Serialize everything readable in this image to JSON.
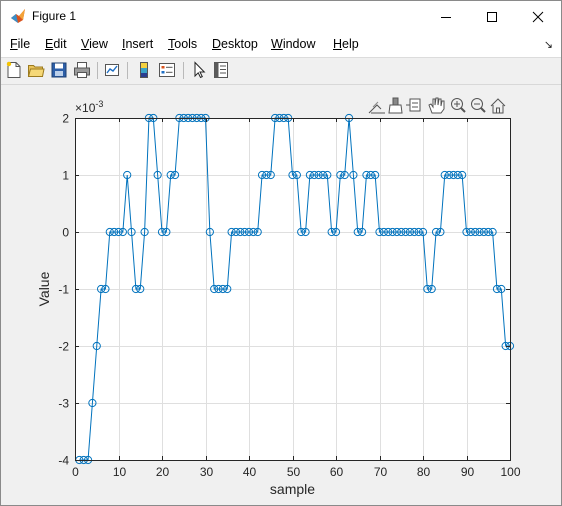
{
  "window": {
    "title": "Figure 1",
    "controls": [
      "minimize-icon",
      "maximize-icon",
      "close-icon"
    ]
  },
  "menu": {
    "items": [
      "File",
      "Edit",
      "View",
      "Insert",
      "Tools",
      "Desktop",
      "Window",
      "Help"
    ],
    "overflow_icon": "dock-arrow-icon"
  },
  "toolbar": {
    "buttons": [
      "new-figure-icon",
      "open-file-icon",
      "save-icon",
      "print-icon",
      "link-plot-icon",
      "insert-colorbar-icon",
      "insert-legend-icon",
      "edit-plot-icon",
      "property-inspector-icon"
    ]
  },
  "axes_toolbar": {
    "buttons": [
      "export-icon",
      "brush-icon",
      "data-tips-icon",
      "pan-icon",
      "zoom-in-icon",
      "zoom-out-icon",
      "restore-view-icon"
    ]
  },
  "chart_data": {
    "type": "line",
    "marker": "circle",
    "color": "#0072bd",
    "xlabel": "sample",
    "ylabel": "Value",
    "exponent_label": "10",
    "exponent_prefix": "×",
    "exponent_power": "-3",
    "xlim": [
      0,
      100
    ],
    "ylim": [
      -4,
      2
    ],
    "grid": true,
    "xticks": [
      "0",
      "10",
      "20",
      "30",
      "40",
      "50",
      "60",
      "70",
      "80",
      "90",
      "100"
    ],
    "yticks": [
      "-4",
      "-3",
      "-2",
      "-1",
      "0",
      "1",
      "2"
    ],
    "x": [
      1,
      2,
      3,
      4,
      5,
      6,
      7,
      8,
      9,
      10,
      11,
      12,
      13,
      14,
      15,
      16,
      17,
      18,
      19,
      20,
      21,
      22,
      23,
      24,
      25,
      26,
      27,
      28,
      29,
      30,
      31,
      32,
      33,
      34,
      35,
      36,
      37,
      38,
      39,
      40,
      41,
      42,
      43,
      44,
      45,
      46,
      47,
      48,
      49,
      50,
      51,
      52,
      53,
      54,
      55,
      56,
      57,
      58,
      59,
      60,
      61,
      62,
      63,
      64,
      65,
      66,
      67,
      68,
      69,
      70,
      71,
      72,
      73,
      74,
      75,
      76,
      77,
      78,
      79,
      80,
      81,
      82,
      83,
      84,
      85,
      86,
      87,
      88,
      89,
      90,
      91,
      92,
      93,
      94,
      95,
      96,
      97,
      98,
      99,
      100
    ],
    "values": [
      -4,
      -4,
      -4,
      -3,
      -2,
      -1,
      -1,
      0,
      0,
      0,
      0,
      1,
      0,
      -1,
      -1,
      0,
      2,
      2,
      1,
      0,
      0,
      1,
      1,
      2,
      2,
      2,
      2,
      2,
      2,
      2,
      0,
      -1,
      -1,
      -1,
      -1,
      0,
      0,
      0,
      0,
      0,
      0,
      0,
      1,
      1,
      1,
      2,
      2,
      2,
      2,
      1,
      1,
      0,
      0,
      1,
      1,
      1,
      1,
      1,
      0,
      0,
      1,
      1,
      2,
      1,
      0,
      0,
      1,
      1,
      1,
      0,
      0,
      0,
      0,
      0,
      0,
      0,
      0,
      0,
      0,
      0,
      -1,
      -1,
      0,
      0,
      1,
      1,
      1,
      1,
      1,
      0,
      0,
      0,
      0,
      0,
      0,
      0,
      -1,
      -1,
      -2,
      -2
    ]
  }
}
